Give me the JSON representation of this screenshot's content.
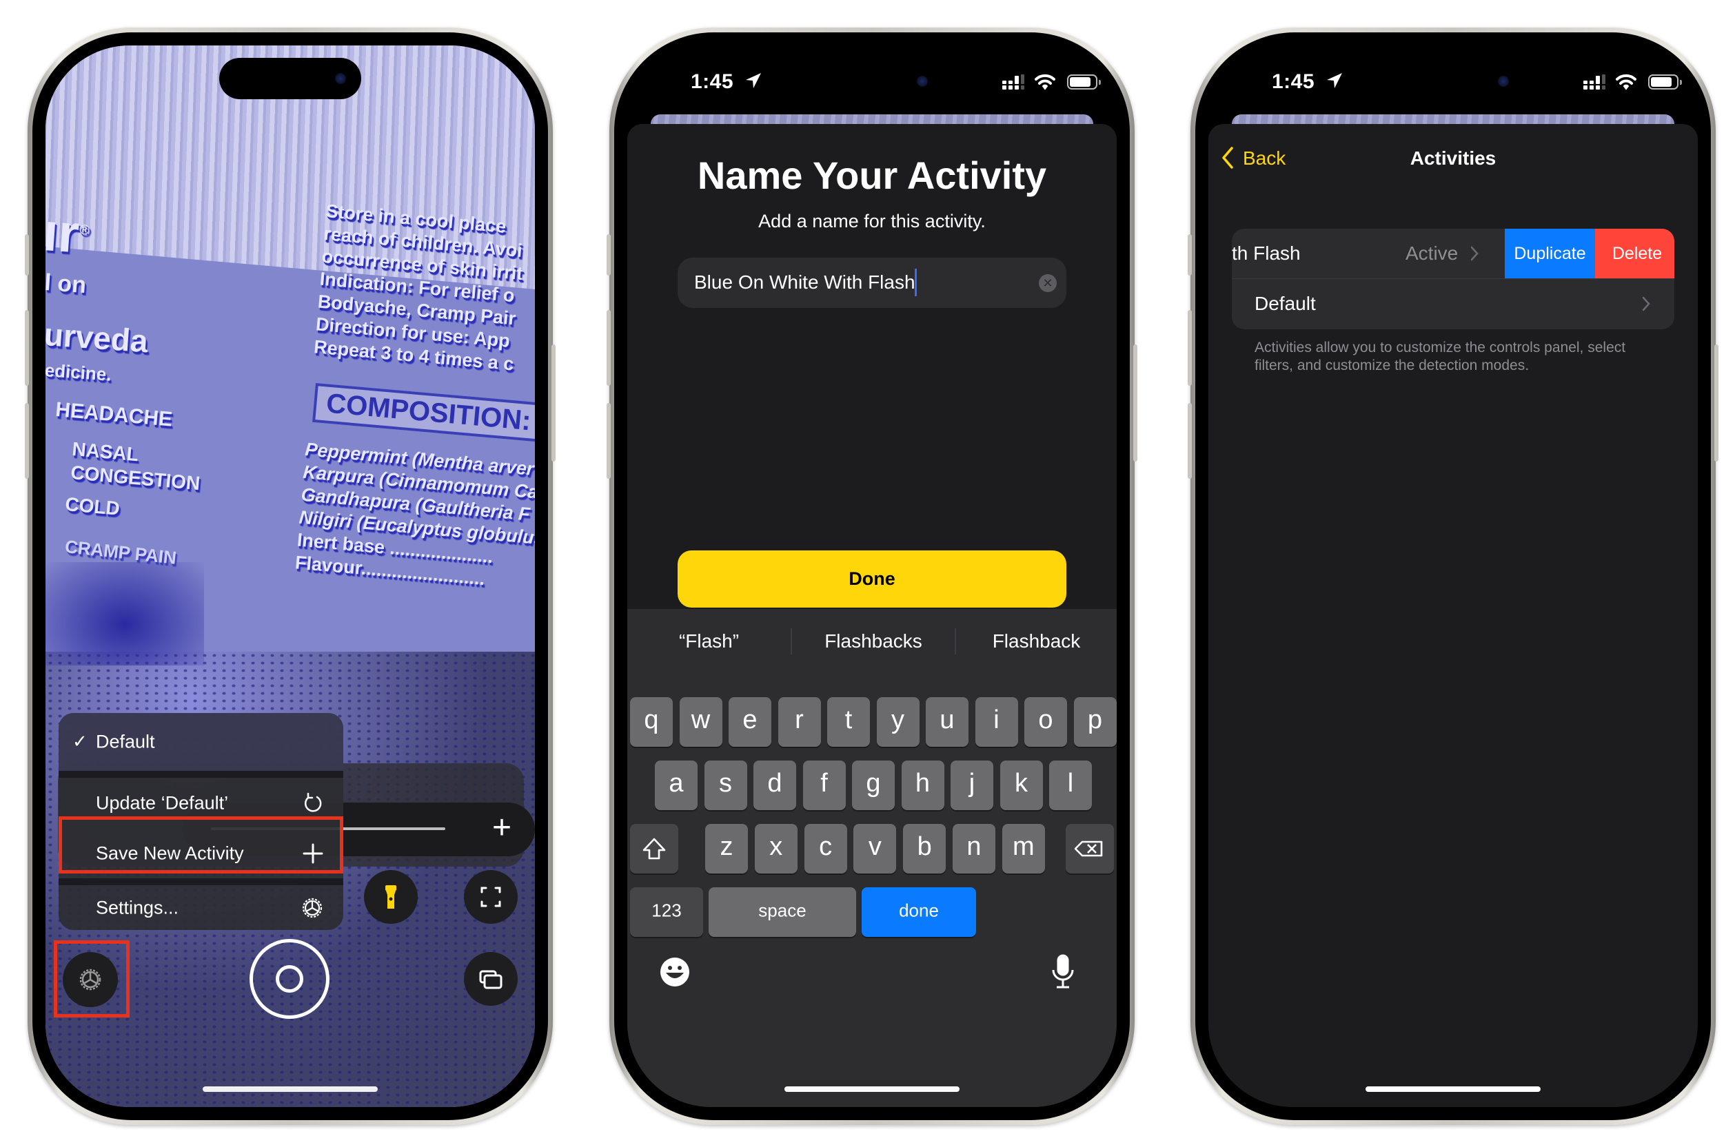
{
  "colors": {
    "accent_yellow": "#FFD60A",
    "highlight_red": "#E8321C",
    "ios_blue": "#0A7AFF",
    "ios_red": "#FF453A",
    "sheet_bg": "#1C1C1E",
    "group_bg": "#2C2C2E",
    "keyboard_bg": "#2D2D30",
    "key_bg": "#6B6B6E",
    "camera_tint": "#8286CC"
  },
  "phone_left": {
    "camera_feed_text": {
      "brand_fragment": "ır",
      "registered": "®",
      "line_on": "l on",
      "line_urveda": "urveda",
      "line_medicine": "edicine.",
      "uses": [
        "HEADACHE",
        "NASAL",
        "CONGESTION",
        "COLD",
        "CRAMP PAIN"
      ],
      "store_lines": [
        "Store in a cool place",
        "reach of children. Avoi",
        "occurrence of skin irrit",
        "Indication: For relief o",
        "Bodyache, Cramp Pair",
        "Direction for use: App",
        "Repeat 3 to 4 times a c"
      ],
      "composition_heading": "COMPOSITION:",
      "composition_lines": [
        "Peppermint (Mentha arver",
        "Karpura (Cinnamomum Ca",
        "Gandhapura (Gaultheria F",
        "Nilgiri (Eucalyptus globulus",
        "Inert base ....................",
        "Flavour........................"
      ]
    },
    "menu": {
      "items": [
        {
          "label": "Default",
          "checked": true,
          "icon": "checkmark-icon"
        },
        {
          "label": "Update ‘Default’",
          "icon": "refresh-icon"
        },
        {
          "label": "Save New Activity",
          "icon": "plus-icon",
          "highlighted": true
        },
        {
          "label": "Settings...",
          "icon": "gear-icon"
        }
      ]
    },
    "controls": {
      "zoom_plus": "+",
      "flashlight_on": true,
      "settings_button_highlighted": true
    }
  },
  "phone_middle": {
    "status": {
      "time": "1:45"
    },
    "title": "Name Your Activity",
    "subtitle": "Add a name for this activity.",
    "input": {
      "value": "Blue On White With Flash",
      "placeholder": ""
    },
    "done_button": "Done",
    "suggestions": [
      "“Flash”",
      "Flashbacks",
      "Flashback"
    ],
    "keyboard": {
      "row1": [
        "q",
        "w",
        "e",
        "r",
        "t",
        "y",
        "u",
        "i",
        "o",
        "p"
      ],
      "row2": [
        "a",
        "s",
        "d",
        "f",
        "g",
        "h",
        "j",
        "k",
        "l"
      ],
      "row3": [
        "z",
        "x",
        "c",
        "v",
        "b",
        "n",
        "m"
      ],
      "numbers_key": "123",
      "space_key": "space",
      "return_key": "done"
    }
  },
  "phone_right": {
    "status": {
      "time": "1:45"
    },
    "nav": {
      "back": "Back",
      "title": "Activities"
    },
    "rows": [
      {
        "label": "th Flash",
        "detail": "Active",
        "swiped": true,
        "actions": [
          "Duplicate",
          "Delete"
        ]
      },
      {
        "label": "Default",
        "detail": ""
      }
    ],
    "footer": "Activities allow you to customize the controls panel, select filters, and customize the detection modes."
  }
}
